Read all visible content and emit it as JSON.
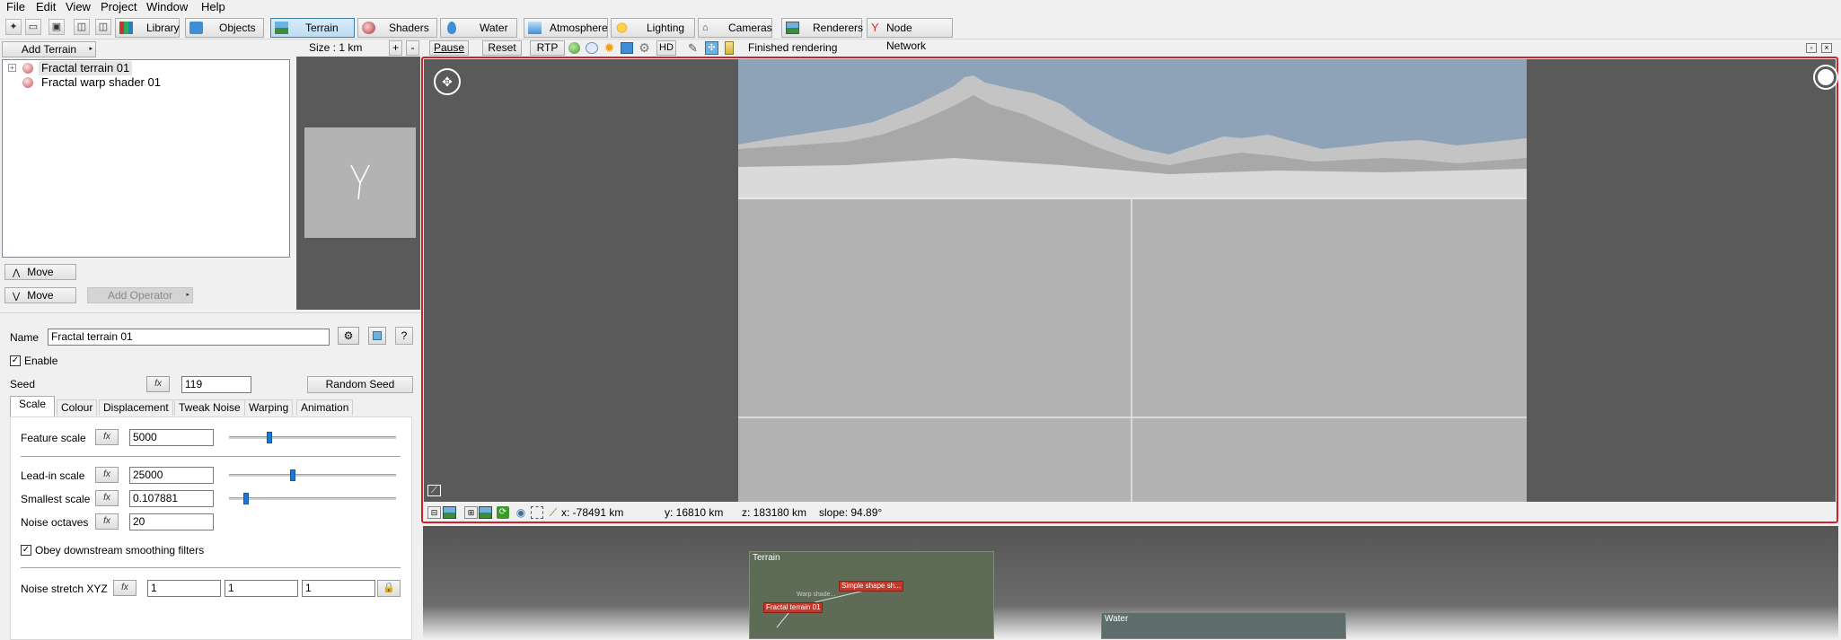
{
  "menu": [
    "File",
    "Edit",
    "View",
    "Project",
    "Window",
    "Help"
  ],
  "toolbar": {
    "tabs": [
      "Library",
      "Objects",
      "Terrain",
      "Shaders",
      "Water",
      "Atmosphere",
      "Lighting",
      "Cameras",
      "Renderers",
      "Node Network"
    ],
    "active_tab": "Terrain"
  },
  "left_panel": {
    "add_terrain_label": "Add Terrain",
    "tree_items": [
      "Fractal terrain 01",
      "Fractal warp shader 01"
    ],
    "move_up_label": "Move",
    "move_down_label": "Move",
    "add_operator_label": "Add Operator"
  },
  "render_bar": {
    "size_label": "Size : 1 km",
    "plus": "+",
    "minus": "-",
    "pause": "Pause",
    "reset": "Reset",
    "rtp": "RTP",
    "hd": "HD",
    "status": "Finished rendering"
  },
  "viewport_status": {
    "x": "x: -78491 km",
    "y": "y: 16810 km",
    "z": "z: 183180 km",
    "slope": "slope: 94.89°"
  },
  "properties": {
    "name_label": "Name",
    "name_value": "Fractal terrain 01",
    "help": "?",
    "enable_label": "Enable",
    "seed_label": "Seed",
    "seed_value": "119",
    "random_seed_label": "Random Seed",
    "tabs": [
      "Scale",
      "Colour",
      "Displacement",
      "Tweak Noise",
      "Warping",
      "Animation"
    ],
    "active_tab": "Scale",
    "feature_scale_label": "Feature scale",
    "feature_scale_value": "5000",
    "feature_scale_slider": 0.24,
    "leadin_scale_label": "Lead-in scale",
    "leadin_scale_value": "25000",
    "leadin_scale_slider": 0.38,
    "smallest_scale_label": "Smallest scale",
    "smallest_scale_value": "0.107881",
    "smallest_scale_slider": 0.1,
    "noise_octaves_label": "Noise octaves",
    "noise_octaves_value": "20",
    "obey_label": "Obey downstream smoothing filters",
    "stretch_label": "Noise stretch XYZ",
    "stretch_x": "1",
    "stretch_y": "1",
    "stretch_z": "1"
  },
  "node_network": {
    "group_terrain": "Terrain",
    "group_water": "Water",
    "node_simple_shape": "Simple shape sh...",
    "node_fractal": "Fractal terrain 01",
    "node_warp": "Warp shade..."
  },
  "colors": {
    "accent_border": "#d0202a",
    "sky": "#8ea3b8",
    "viewport_bg": "#5a5a5a",
    "slider_thumb": "#1e78d2"
  }
}
